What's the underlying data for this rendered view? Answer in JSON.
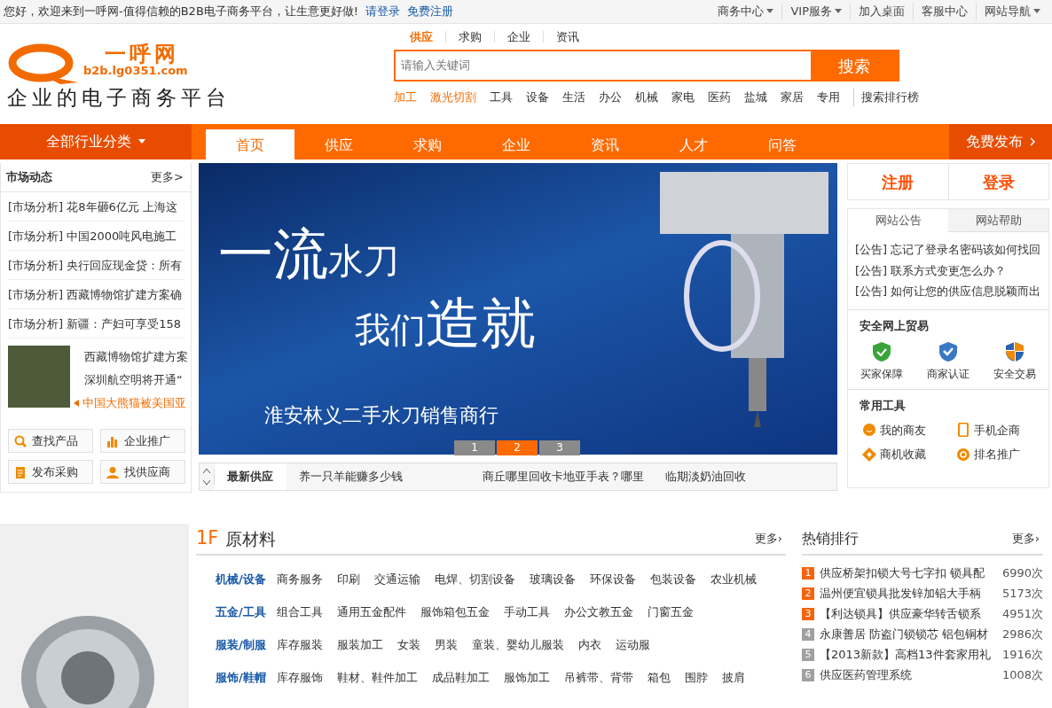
{
  "top_bar": {
    "welcome": "您好，欢迎来到一呼网-值得信赖的B2B电子商务平台，让生意更好做!",
    "links": [
      "请登录",
      "免费注册"
    ],
    "menu": [
      {
        "label": "商务中心",
        "dropdown": true
      },
      {
        "label": "VIP服务",
        "dropdown": true
      },
      {
        "label": "加入桌面",
        "dropdown": false
      },
      {
        "label": "客服中心",
        "dropdown": false
      },
      {
        "label": "网站导航",
        "dropdown": true
      }
    ]
  },
  "logo": {
    "name": "一呼网",
    "domain": "b2b.lg0351.com",
    "slogan": "企业的电子商务平台"
  },
  "search": {
    "tabs": [
      {
        "label": "供应",
        "selected": true
      },
      {
        "label": "求购",
        "selected": false
      },
      {
        "label": "企业",
        "selected": false
      },
      {
        "label": "资讯",
        "selected": false
      }
    ],
    "placeholder": "请输入关键词",
    "button": "搜索",
    "hot_words": [
      {
        "label": "加工",
        "highlight": true
      },
      {
        "label": "激光切割",
        "highlight": true
      },
      {
        "label": "工具",
        "highlight": false
      },
      {
        "label": "设备",
        "highlight": false
      },
      {
        "label": "生活",
        "highlight": false
      },
      {
        "label": "办公",
        "highlight": false
      },
      {
        "label": "机械",
        "highlight": false
      },
      {
        "label": "家电",
        "highlight": false
      },
      {
        "label": "医药",
        "highlight": false
      },
      {
        "label": "盐城",
        "highlight": false
      },
      {
        "label": "家居",
        "highlight": false
      },
      {
        "label": "专用",
        "highlight": false
      }
    ],
    "ranking_link": "搜索排行榜"
  },
  "nav": {
    "category_button": "全部行业分类",
    "items": [
      {
        "label": "首页",
        "selected": true
      },
      {
        "label": "供应",
        "selected": false
      },
      {
        "label": "求购",
        "selected": false
      },
      {
        "label": "企业",
        "selected": false
      },
      {
        "label": "资讯",
        "selected": false
      },
      {
        "label": "人才",
        "selected": false
      },
      {
        "label": "问答",
        "selected": false
      }
    ],
    "publish_button": "免费发布"
  },
  "market_news": {
    "title": "市场动态",
    "more": "更多>",
    "items": [
      {
        "tag": "[市场分析]",
        "text": "花8年砸6亿元 上海这"
      },
      {
        "tag": "[市场分析]",
        "text": "中国2000吨风电施工"
      },
      {
        "tag": "[市场分析]",
        "text": "央行回应现金贷：所有"
      },
      {
        "tag": "[市场分析]",
        "text": "西藏博物馆扩建方案确"
      },
      {
        "tag": "[市场分析]",
        "text": "新疆：产妇可享受158"
      }
    ],
    "photo_news": [
      {
        "text": "西藏博物馆扩建方案",
        "selected": false
      },
      {
        "text": "深圳航空明将开通“",
        "selected": false
      },
      {
        "text": "中国大熊猫被美国亚",
        "selected": true
      }
    ]
  },
  "quick_buttons": [
    {
      "label": "查找产品",
      "kind": "search"
    },
    {
      "label": "企业推广",
      "kind": "chart"
    },
    {
      "label": "发布采购",
      "kind": "document"
    },
    {
      "label": "找供应商",
      "kind": "person"
    }
  ],
  "banner": {
    "headline_big": "一流",
    "headline_small": "水刀",
    "line2_small": "我们",
    "line2_big": "造就",
    "caption": "淮安林义二手水刀销售商行",
    "pages": [
      {
        "label": "1",
        "selected": false
      },
      {
        "label": "2",
        "selected": true
      },
      {
        "label": "3",
        "selected": false
      }
    ]
  },
  "latest_supply": {
    "title": "最新供应",
    "items": [
      "养一只羊能赚多少钱",
      "商丘哪里回收卡地亚手表？哪里",
      "临期淡奶油回收"
    ]
  },
  "account": {
    "buttons": [
      "注册",
      "登录"
    ]
  },
  "notices": {
    "tabs": [
      {
        "label": "网站公告",
        "selected": true
      },
      {
        "label": "网站帮助",
        "selected": false
      }
    ],
    "items": [
      {
        "tag": "[公告]",
        "text": "忘记了登录名密码该如何找回"
      },
      {
        "tag": "[公告]",
        "text": "联系方式变更怎么办？"
      },
      {
        "tag": "[公告]",
        "text": "如何让您的供应信息脱颖而出"
      }
    ]
  },
  "safe_trade": {
    "title": "安全网上贸易",
    "items": [
      {
        "label": "买家保障",
        "kind": "guarantee"
      },
      {
        "label": "商家认证",
        "kind": "verified"
      },
      {
        "label": "安全交易",
        "kind": "secure"
      }
    ]
  },
  "tools": {
    "title": "常用工具",
    "items": [
      {
        "label": "我的商友",
        "kind": "friends"
      },
      {
        "label": "手机企商",
        "kind": "mobile"
      },
      {
        "label": "商机收藏",
        "kind": "favorite"
      },
      {
        "label": "排名推广",
        "kind": "promote"
      }
    ]
  },
  "floor": {
    "number": "1F",
    "title": "原材料",
    "more": "更多›",
    "categories": [
      {
        "name": "机械/设备",
        "items": [
          "商务服务",
          "印刷",
          "交通运输",
          "电焊、切割设备",
          "玻璃设备",
          "环保设备",
          "包装设备",
          "农业机械"
        ]
      },
      {
        "name": "五金/工具",
        "items": [
          "组合工具",
          "通用五金配件",
          "服饰箱包五金",
          "手动工具",
          "办公文教五金",
          "门窗五金"
        ]
      },
      {
        "name": "服装/制服",
        "items": [
          "库存服装",
          "服装加工",
          "女装",
          "男装",
          "童装、婴幼儿服装",
          "内衣",
          "运动服"
        ]
      },
      {
        "name": "服饰/鞋帽",
        "items": [
          "库存服饰",
          "鞋材、鞋件加工",
          "成品鞋加工",
          "服饰加工",
          "吊裤带、背带",
          "箱包",
          "围脖",
          "披肩"
        ]
      }
    ]
  },
  "hot_ranking": {
    "title": "热销排行",
    "more": "更多›",
    "items": [
      {
        "rank": "1",
        "text": "供应桥架扣锁大号七字扣 锁具配",
        "count": "6990次",
        "color": "#f7630c"
      },
      {
        "rank": "2",
        "text": "温州便宜锁具批发锌加铝大手柄",
        "count": "5173次",
        "color": "#f7630c"
      },
      {
        "rank": "3",
        "text": "【利达锁具】供应豪华转舌锁系",
        "count": "4951次",
        "color": "#f7630c"
      },
      {
        "rank": "4",
        "text": "永康善居 防盗门锁锁芯 铝包铜材",
        "count": "2986次",
        "color": "#a0a0a0"
      },
      {
        "rank": "5",
        "text": "【2013新款】高档13件套家用礼",
        "count": "1916次",
        "color": "#a0a0a0"
      },
      {
        "rank": "6",
        "text": "供应医药管理系统",
        "count": "1008次",
        "color": "#a0a0a0"
      }
    ]
  }
}
